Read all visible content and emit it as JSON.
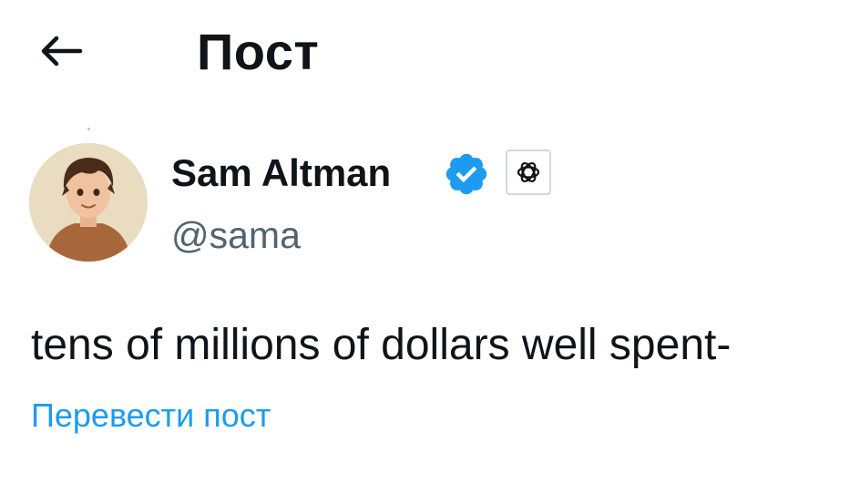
{
  "header": {
    "title": "Пост",
    "back_icon": "arrow-left-icon"
  },
  "author": {
    "name": "Sam Altman",
    "handle": "@sama",
    "verified_icon": "verified-badge-icon",
    "affiliate_icon": "openai-logo-icon",
    "verified_color": "#1d9bf0"
  },
  "post": {
    "text": "tens of millions of dollars well spent-",
    "translate_label": "Перевести пост"
  },
  "colors": {
    "accent": "#1d9bf0",
    "secondary_text": "#536471",
    "primary_text": "#0f1419"
  }
}
